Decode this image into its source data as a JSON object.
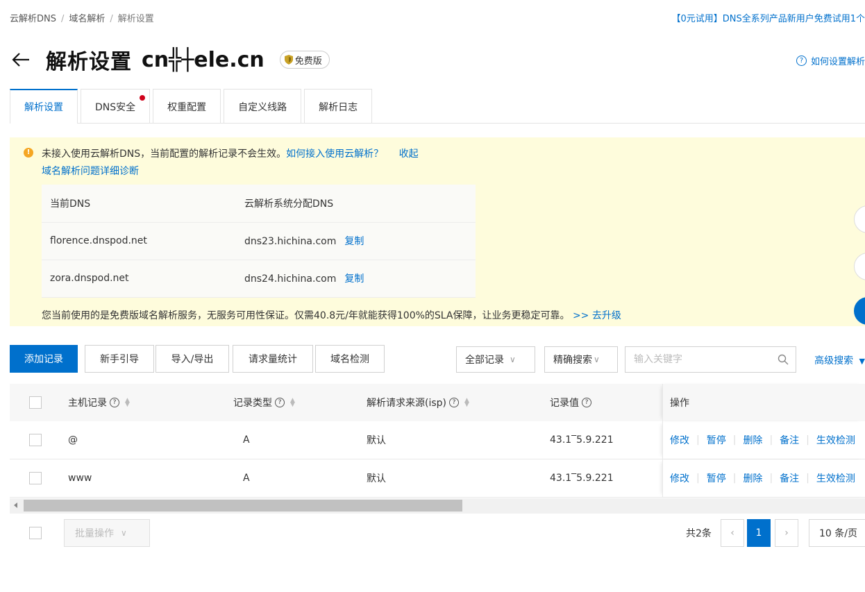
{
  "breadcrumb": {
    "items": [
      "云解析DNS",
      "域名解析",
      "解析设置"
    ],
    "separator": "/"
  },
  "promo": "【0元试用】DNS全系列产品新用户免费试用1个",
  "header": {
    "title": "解析设置",
    "domain": "cn╬┼ele.cn",
    "badge": "免费版",
    "help_link": "如何设置解析"
  },
  "tabs": [
    {
      "label": "解析设置",
      "active": true
    },
    {
      "label": "DNS安全",
      "dot": true
    },
    {
      "label": "权重配置"
    },
    {
      "label": "自定义线路"
    },
    {
      "label": "解析日志"
    }
  ],
  "notice": {
    "message": "未接入使用云解析DNS，当前配置的解析记录不会生效。",
    "how_link": "如何接入使用云解析？",
    "collapse_link": "收起",
    "diagnose_link": "域名解析问题详细诊断",
    "dns_table": {
      "headers": [
        "当前DNS",
        "云解析系统分配DNS"
      ],
      "rows": [
        {
          "current": "florence.dnspod.net",
          "assigned": "dns23.hichina.com"
        },
        {
          "current": "zora.dnspod.net",
          "assigned": "dns24.hichina.com"
        }
      ],
      "copy_label": "复制"
    },
    "upgrade_text": "您当前使用的是免费版域名解析服务，无服务可用性保证。仅需40.8元/年就能获得100%的SLA保障，让业务更稳定可靠。",
    "upgrade_link": ">> 去升级"
  },
  "toolbar": {
    "add": "添加记录",
    "guide": "新手引导",
    "import_export": "导入/导出",
    "stats": "请求量统计",
    "check": "域名检测",
    "filter": "全部记录",
    "search_mode": "精确搜索",
    "search_placeholder": "输入关键字",
    "advanced": "高级搜索"
  },
  "table": {
    "headers": {
      "host": "主机记录",
      "type": "记录类型",
      "isp": "解析请求来源(isp)",
      "value": "记录值",
      "ops": "操作"
    },
    "rows": [
      {
        "host": "@",
        "type": "A",
        "isp": "默认",
        "value": "43.1‾5.9.221"
      },
      {
        "host": "www",
        "type": "A",
        "isp": "默认",
        "value": "43.1‾5.9.221"
      }
    ],
    "ops": [
      "修改",
      "暂停",
      "删除",
      "备注",
      "生效检测"
    ]
  },
  "footer": {
    "batch": "批量操作",
    "total": "共2条",
    "current_page": "1",
    "page_size": "10 条/页"
  },
  "colors": {
    "primary": "#0070cc",
    "notice_bg": "#fefcdc",
    "warn": "#f5a623",
    "dot": "#d0021b"
  }
}
